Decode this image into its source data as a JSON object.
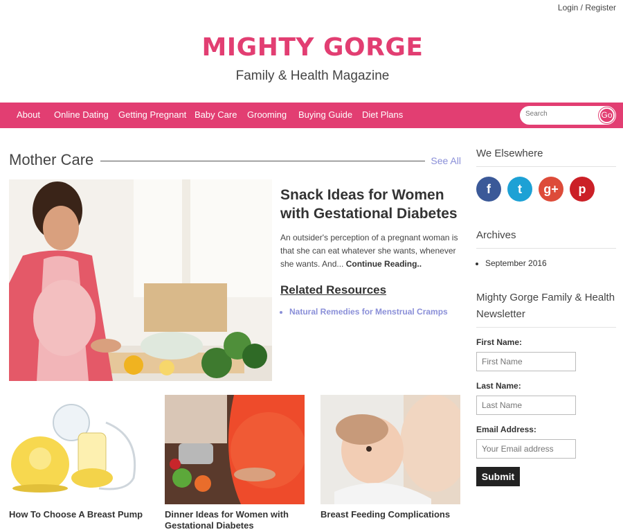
{
  "header": {
    "login_label": "Login",
    "separator": " / ",
    "register_label": "Register",
    "site_title": "MIGHTY GORGE",
    "tagline": "Family & Health Magazine"
  },
  "nav": {
    "items": [
      "About",
      "Online Dating",
      "Getting Pregnant",
      "Baby Care",
      "Grooming",
      "Buying Guide",
      "Diet Plans"
    ],
    "search_placeholder": "Search",
    "go_label": "Go"
  },
  "section": {
    "title": "Mother Care",
    "see_all": "See All"
  },
  "feature": {
    "title": "Snack Ideas for Women with Gestational Diabetes",
    "excerpt": "An outsider's perception of a pregnant woman is that she can eat whatever she wants, whenever she wants. And...",
    "continue_label": "Continue Reading..",
    "related_heading": "Related Resources",
    "related_links": [
      "Natural Remedies for Menstrual Cramps"
    ]
  },
  "thumbs": [
    {
      "caption": "How To Choose A Breast Pump"
    },
    {
      "caption": "Dinner Ideas for Women with Gestational Diabetes"
    },
    {
      "caption": "Breast Feeding Complications"
    }
  ],
  "sidebar": {
    "elsewhere_title": "We Elsewhere",
    "social": [
      {
        "icon": "facebook-icon",
        "glyph": "f",
        "color": "#3b5998"
      },
      {
        "icon": "twitter-icon",
        "glyph": "t",
        "color": "#1da1d5"
      },
      {
        "icon": "google-plus-icon",
        "glyph": "g+",
        "color": "#dd4b39"
      },
      {
        "icon": "pinterest-icon",
        "glyph": "p",
        "color": "#cb2027"
      }
    ],
    "archives_title": "Archives",
    "archives": [
      "September 2016"
    ],
    "newsletter_title": "Mighty Gorge Family & Health Newsletter",
    "first_name_label": "First Name:",
    "first_name_placeholder": "First Name",
    "last_name_label": "Last Name:",
    "last_name_placeholder": "Last Name",
    "email_label": "Email Address:",
    "email_placeholder": "Your Email address",
    "submit_label": "Submit"
  },
  "colors": {
    "brand_pink": "#e23e72",
    "link_purple": "#8a8fd8"
  }
}
